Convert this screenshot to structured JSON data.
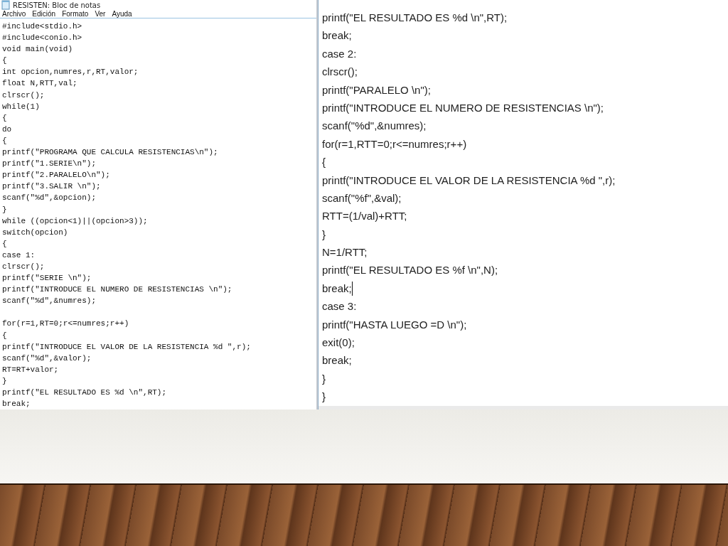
{
  "left_window": {
    "title": "RESISTEN: Bloc de notas",
    "menu": [
      {
        "label": "Archivo"
      },
      {
        "label": "Edición"
      },
      {
        "label": "Formato"
      },
      {
        "label": "Ver"
      },
      {
        "label": "Ayuda"
      }
    ],
    "lines": [
      {
        "text": "#include<stdio.h>"
      },
      {
        "text": "#include<conio.h>"
      },
      {
        "text": "void main(void)"
      },
      {
        "text": "{"
      },
      {
        "text": "int opcion,numres,r,RT,valor;"
      },
      {
        "text": "float N,RTT,val;"
      },
      {
        "text": "clrscr();"
      },
      {
        "text": "while(1)"
      },
      {
        "text": "{"
      },
      {
        "text": "do"
      },
      {
        "text": "{"
      },
      {
        "text": "printf(\"PROGRAMA QUE CALCULA RESISTENCIAS\\n\");"
      },
      {
        "text": "printf(\"1.SERIE\\n\");"
      },
      {
        "text": "printf(\"2.PARALELO\\n\");"
      },
      {
        "text": "printf(\"3.SALIR \\n\");"
      },
      {
        "text": "scanf(\"%d\",&opcion);"
      },
      {
        "text": "}"
      },
      {
        "text": "while ((opcion<1)||(opcion>3));"
      },
      {
        "text": "switch(opcion)"
      },
      {
        "text": "{"
      },
      {
        "text": "case 1:"
      },
      {
        "text": "clrscr();"
      },
      {
        "text": "printf(\"SERIE \\n\");"
      },
      {
        "text": "printf(\"INTRODUCE EL NUMERO DE RESISTENCIAS \\n\");"
      },
      {
        "text": "scanf(\"%d\",&numres);"
      },
      {
        "text": "for(r=1,RT=0;r<=numres;r++)",
        "gap_before": true
      },
      {
        "text": "{"
      },
      {
        "text": "printf(\"INTRODUCE EL VALOR DE LA RESISTENCIA %d \",r);"
      },
      {
        "text": "scanf(\"%d\",&valor);"
      },
      {
        "text": "RT=RT+valor;"
      },
      {
        "text": "}"
      },
      {
        "text": "printf(\"EL RESULTADO ES %d \\n\",RT);"
      },
      {
        "text": "break;"
      }
    ]
  },
  "right_window": {
    "lines": [
      {
        "text": "printf(\"EL RESULTADO ES %d \\n\",RT);",
        "cursor": false
      },
      {
        "text": "break;",
        "cursor": false
      },
      {
        "text": "case 2:",
        "cursor": false
      },
      {
        "text": "clrscr();",
        "cursor": false
      },
      {
        "text": "printf(\"PARALELO \\n\");",
        "cursor": false
      },
      {
        "text": "printf(\"INTRODUCE EL NUMERO DE RESISTENCIAS \\n\");",
        "cursor": false
      },
      {
        "text": "scanf(\"%d\",&numres);",
        "cursor": false
      },
      {
        "text": "for(r=1,RTT=0;r<=numres;r++)",
        "cursor": false
      },
      {
        "text": "{",
        "cursor": false
      },
      {
        "text": "printf(\"INTRODUCE EL VALOR DE LA RESISTENCIA %d \",r);",
        "cursor": false
      },
      {
        "text": "scanf(\"%f\",&val);",
        "cursor": false
      },
      {
        "text": "RTT=(1/val)+RTT;",
        "cursor": false
      },
      {
        "text": "}",
        "cursor": false
      },
      {
        "text": "N=1/RTT;",
        "cursor": false
      },
      {
        "text": "printf(\"EL RESULTADO ES %f \\n\",N);",
        "cursor": false
      },
      {
        "text": "break;",
        "cursor": true
      },
      {
        "text": "case 3:",
        "cursor": false
      },
      {
        "text": "printf(\"HASTA LUEGO =D \\n\");",
        "cursor": false
      },
      {
        "text": "exit(0);",
        "cursor": false
      },
      {
        "text": "break;",
        "cursor": false
      },
      {
        "text": "}",
        "cursor": false
      },
      {
        "text": "}",
        "cursor": false
      }
    ]
  }
}
